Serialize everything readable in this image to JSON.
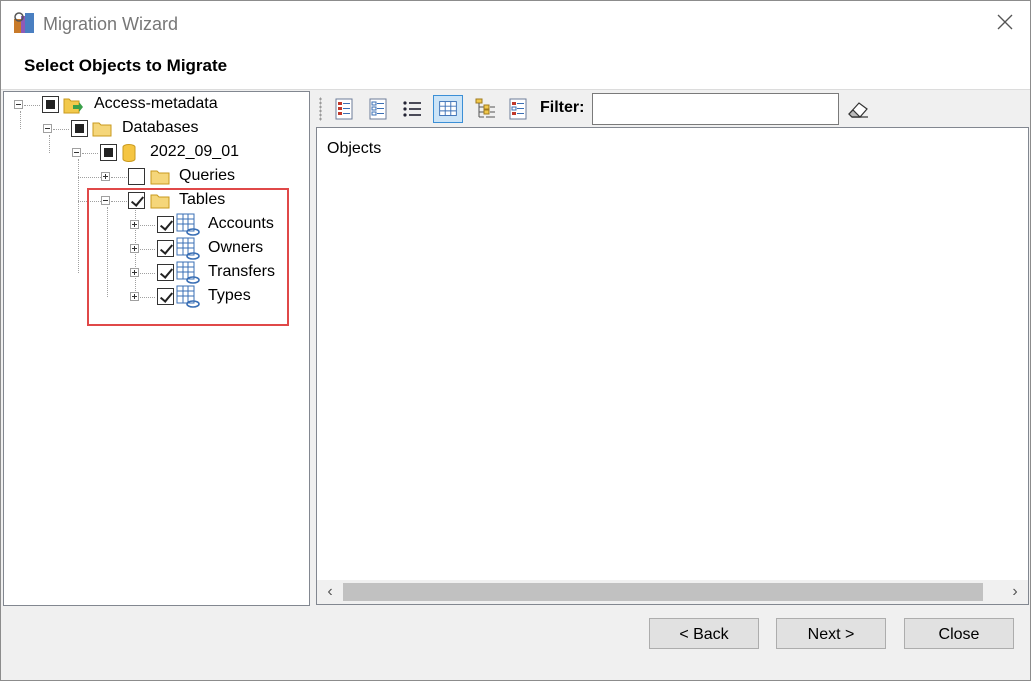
{
  "window": {
    "title": "Migration Wizard"
  },
  "header": {
    "title": "Select Objects to Migrate"
  },
  "tree": {
    "nodes": [
      {
        "label": "Access-metadata",
        "state": "partial"
      },
      {
        "label": "Databases",
        "state": "partial"
      },
      {
        "label": "2022_09_01",
        "state": "partial"
      },
      {
        "label": "Queries",
        "state": "unchecked"
      },
      {
        "label": "Tables",
        "state": "checked"
      },
      {
        "label": "Accounts",
        "state": "checked"
      },
      {
        "label": "Owners",
        "state": "checked"
      },
      {
        "label": "Transfers",
        "state": "checked"
      },
      {
        "label": "Types",
        "state": "checked"
      }
    ]
  },
  "toolbar": {
    "icons": [
      "check-all-icon",
      "uncheck-all-icon",
      "list-view-icon",
      "grid-view-icon",
      "tree-view-icon",
      "checked-list-icon"
    ],
    "filter_label": "Filter:",
    "filter_value": "",
    "clear_icon": "eraser-icon"
  },
  "objects": {
    "header": "Objects"
  },
  "buttons": {
    "back": "< Back",
    "next": "Next >",
    "close": "Close"
  },
  "colors": {
    "highlight": "#e04848",
    "active_tool": "#cce4f7"
  }
}
